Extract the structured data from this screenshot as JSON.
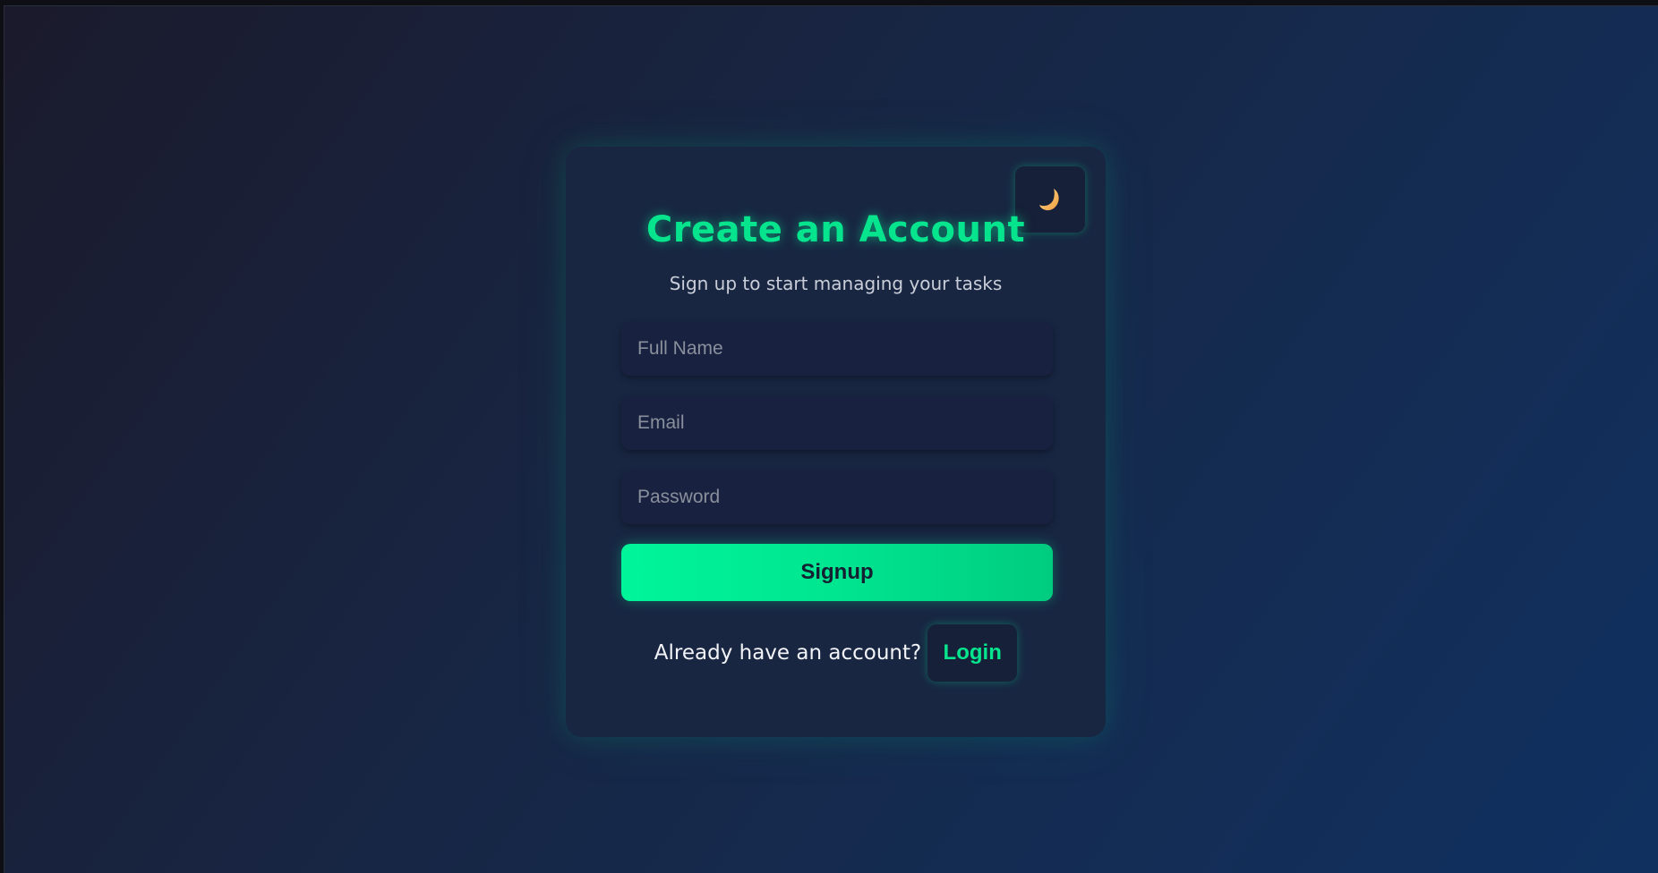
{
  "theme_toggle": {
    "icon": "crescent-moon-icon",
    "glyph": "🌙"
  },
  "signup_form": {
    "title": "Create an Account",
    "subtitle": "Sign up to start managing your tasks",
    "full_name": {
      "value": "",
      "placeholder": "Full Name"
    },
    "email": {
      "value": "",
      "placeholder": "Email"
    },
    "password": {
      "value": "",
      "placeholder": "Password"
    },
    "submit_label": "Signup",
    "login_prompt": "Already have an account?",
    "login_label": "Login"
  },
  "colors": {
    "accent": "#06e58d",
    "card_background": "#182642",
    "page_gradient_start": "#1b1a2c",
    "page_gradient_end": "#103060",
    "button_text": "#132032"
  }
}
